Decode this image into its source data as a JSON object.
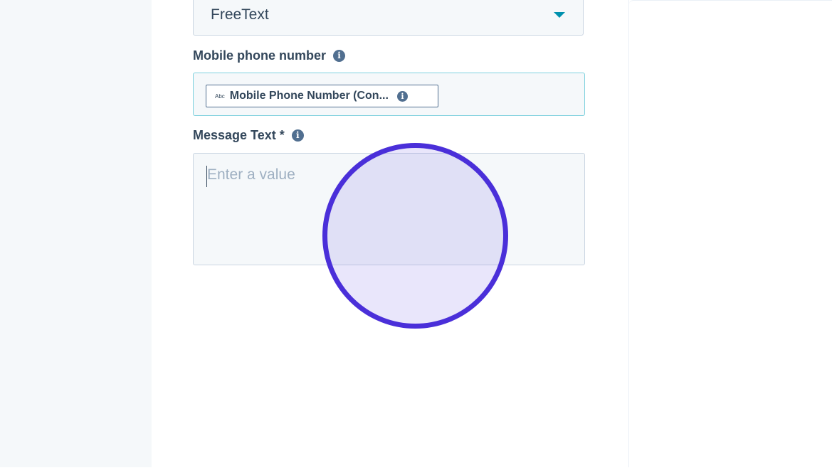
{
  "select": {
    "value": "FreeText",
    "icon": "caret-down-icon",
    "caret_color": "#0091ae"
  },
  "mobile_field": {
    "label": "Mobile phone number",
    "info_icon": "info-icon",
    "token": {
      "type_badge": "Abc",
      "label": "Mobile Phone Number (Con...",
      "info_icon": "info-icon"
    }
  },
  "message_field": {
    "label": "Message Text *",
    "info_icon": "info-icon",
    "placeholder": "Enter a value",
    "value": ""
  },
  "colors": {
    "label_text": "#33475b",
    "input_bg": "#f5f8fa",
    "focus_border": "#7fd1de",
    "click_indicator": "#4a2fd9"
  }
}
